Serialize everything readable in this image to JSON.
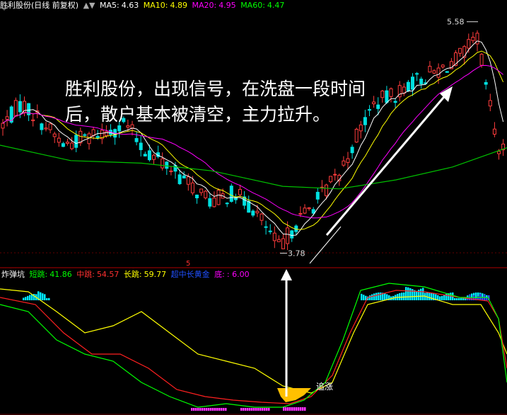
{
  "upper": {
    "title": "胜利股份(日线 前复权)",
    "ma": [
      {
        "label": "MA5:",
        "value": "4.63",
        "color": "#ffffff"
      },
      {
        "label": "MA10:",
        "value": "4.89",
        "color": "#ffff00"
      },
      {
        "label": "MA20:",
        "value": "4.95",
        "color": "#ff00ff"
      },
      {
        "label": "MA60:",
        "value": "4.47",
        "color": "#00ff00"
      }
    ],
    "high_label": "5.58",
    "low_label": "3.78",
    "annotation_line1": "胜利股份，出现信号，在洗盘一段时间",
    "annotation_line2": "后，散户基本被清空，主力拉升。"
  },
  "lower": {
    "name": "炸弹坑",
    "items": [
      {
        "label": "短跳:",
        "value": "41.86",
        "color": "#00ff00"
      },
      {
        "label": "中跳:",
        "value": "54.57",
        "color": "#ff3030"
      },
      {
        "label": "长跳:",
        "value": "59.77",
        "color": "#ffff00"
      },
      {
        "label": "超中长黄金",
        "value": "",
        "color": "#2050ff"
      },
      {
        "label": "底:",
        "value": ": 6.00",
        "color": "#ff00ff"
      }
    ],
    "signal_label": "追涨",
    "marker_label": "5"
  },
  "chart_data": [
    {
      "type": "candlestick",
      "title": "胜利股份(日线 前复权)",
      "series": [
        {
          "name": "MA5",
          "last": 4.63
        },
        {
          "name": "MA10",
          "last": 4.89
        },
        {
          "name": "MA20",
          "last": 4.95
        },
        {
          "name": "MA60",
          "last": 4.47
        }
      ],
      "annotations": [
        "5.58",
        "3.78"
      ],
      "ylim": [
        3.7,
        5.65
      ]
    },
    {
      "type": "line",
      "title": "炸弹坑",
      "series": [
        {
          "name": "短跳",
          "last": 41.86
        },
        {
          "name": "中跳",
          "last": 54.57
        },
        {
          "name": "长跳",
          "last": 59.77
        }
      ],
      "annotations": [
        "追涨"
      ]
    }
  ]
}
